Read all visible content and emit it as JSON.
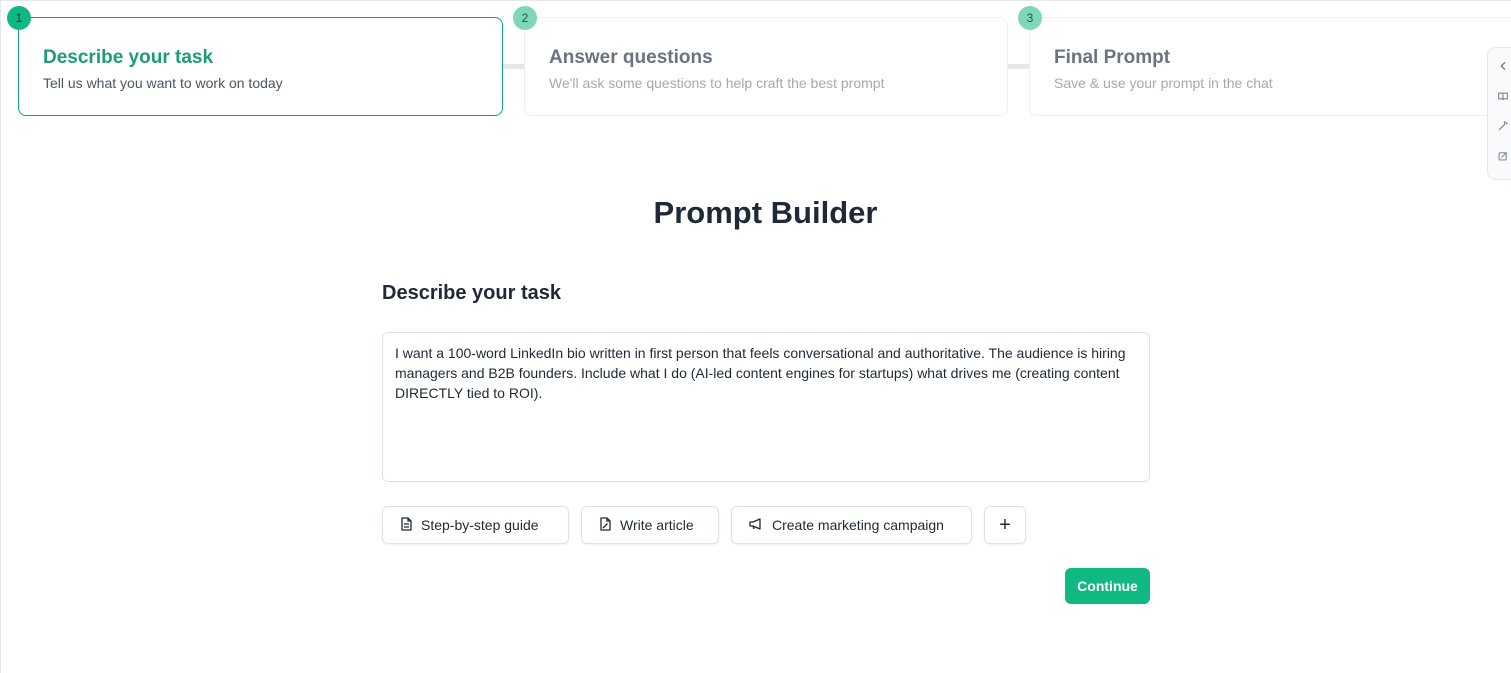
{
  "stepper": {
    "steps": [
      {
        "number": "1",
        "title": "Describe your task",
        "description": "Tell us what you want to work on today",
        "active": true
      },
      {
        "number": "2",
        "title": "Answer questions",
        "description": "We'll ask some questions to help craft the best prompt",
        "active": false
      },
      {
        "number": "3",
        "title": "Final Prompt",
        "description": "Save & use your prompt in the chat",
        "active": false
      }
    ]
  },
  "main": {
    "title": "Prompt Builder",
    "section_label": "Describe your task",
    "task_text": "I want a 100-word LinkedIn bio written in first person that feels conversational and authoritative. The audience is hiring managers and B2B founders. Include what I do (AI-led content engines for startups) what drives me (creating content DIRECTLY tied to ROI).",
    "templates": [
      {
        "label": "Step-by-step guide",
        "icon": "document-icon"
      },
      {
        "label": "Write article",
        "icon": "edit-document-icon"
      },
      {
        "label": "Create marketing campaign",
        "icon": "megaphone-icon"
      }
    ],
    "add_template_symbol": "+",
    "continue_label": "Continue"
  },
  "side_rail": {
    "icons": [
      "chevron-left-icon",
      "book-icon",
      "magic-wand-icon",
      "edit-square-icon"
    ]
  },
  "colors": {
    "accent": "#10b981",
    "accent_text": "#1e9b78",
    "inactive_badge": "#7fd7b9"
  }
}
